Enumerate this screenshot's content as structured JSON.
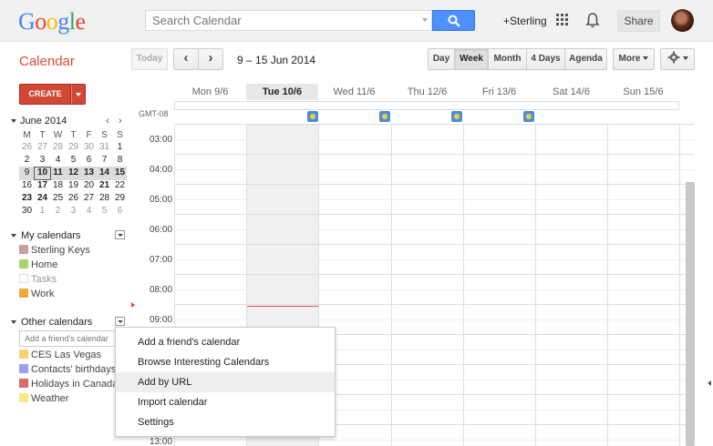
{
  "header": {
    "logo": {
      "g": "G",
      "o1": "o",
      "o2": "o",
      "g2": "g",
      "l": "l",
      "e": "e"
    },
    "search_placeholder": "Search Calendar",
    "user_link": "+Sterling",
    "share_label": "Share"
  },
  "toolbar": {
    "app_title": "Calendar",
    "today_label": "Today",
    "prev_label": "‹",
    "next_label": "›",
    "date_range": "9 – 15 Jun 2014",
    "views": {
      "day": "Day",
      "week": "Week",
      "month": "Month",
      "four_days": "4 Days",
      "agenda": "Agenda"
    },
    "more_label": "More"
  },
  "sidebar": {
    "create_label": "CREATE",
    "mini_calendar": {
      "month_label": "June 2014",
      "prev": "‹",
      "next": "›",
      "dow": [
        "M",
        "T",
        "W",
        "T",
        "F",
        "S",
        "S"
      ],
      "weeks": [
        [
          "26",
          "27",
          "28",
          "29",
          "30",
          "31",
          "1"
        ],
        [
          "2",
          "3",
          "4",
          "5",
          "6",
          "7",
          "8"
        ],
        [
          "9",
          "10",
          "11",
          "12",
          "13",
          "14",
          "15"
        ],
        [
          "16",
          "17",
          "18",
          "19",
          "20",
          "21",
          "22"
        ],
        [
          "23",
          "24",
          "25",
          "26",
          "27",
          "28",
          "29"
        ],
        [
          "30",
          "1",
          "2",
          "3",
          "4",
          "5",
          "6"
        ]
      ]
    },
    "my_calendars": {
      "title": "My calendars",
      "items": [
        {
          "label": "Sterling Keys",
          "color": "#c9a0a0"
        },
        {
          "label": "Home",
          "color": "#a6d66e"
        },
        {
          "label": "Tasks",
          "color": "#ffffff"
        },
        {
          "label": "Work",
          "color": "#f4a73a"
        }
      ]
    },
    "other_calendars": {
      "title": "Other calendars",
      "friend_placeholder": "Add a friend's calendar",
      "items": [
        {
          "label": "CES Las Vegas",
          "color": "#f6d36e"
        },
        {
          "label": "Contacts' birthdays a",
          "color": "#9e9ef0"
        },
        {
          "label": "Holidays in Canada",
          "color": "#d96b6b"
        },
        {
          "label": "Weather",
          "color": "#f7e88a"
        }
      ]
    }
  },
  "week": {
    "timezone": "GMT-08",
    "days": [
      "Mon 9/6",
      "Tue 10/6",
      "Wed 11/6",
      "Thu 12/6",
      "Fri 13/6",
      "Sat 14/6",
      "Sun 15/6"
    ],
    "today_index": 1,
    "hours": [
      "03:00",
      "04:00",
      "05:00",
      "06:00",
      "07:00",
      "08:00",
      "09:00",
      "13:00"
    ]
  },
  "menu": {
    "items": [
      "Add a friend's calendar",
      "Browse Interesting Calendars",
      "Add by URL",
      "Import calendar",
      "Settings"
    ],
    "hovered_index": 2
  },
  "colors": {
    "accent": "#dd4b39",
    "search_button": "#4d90fe",
    "now_line": "#e8554e"
  }
}
